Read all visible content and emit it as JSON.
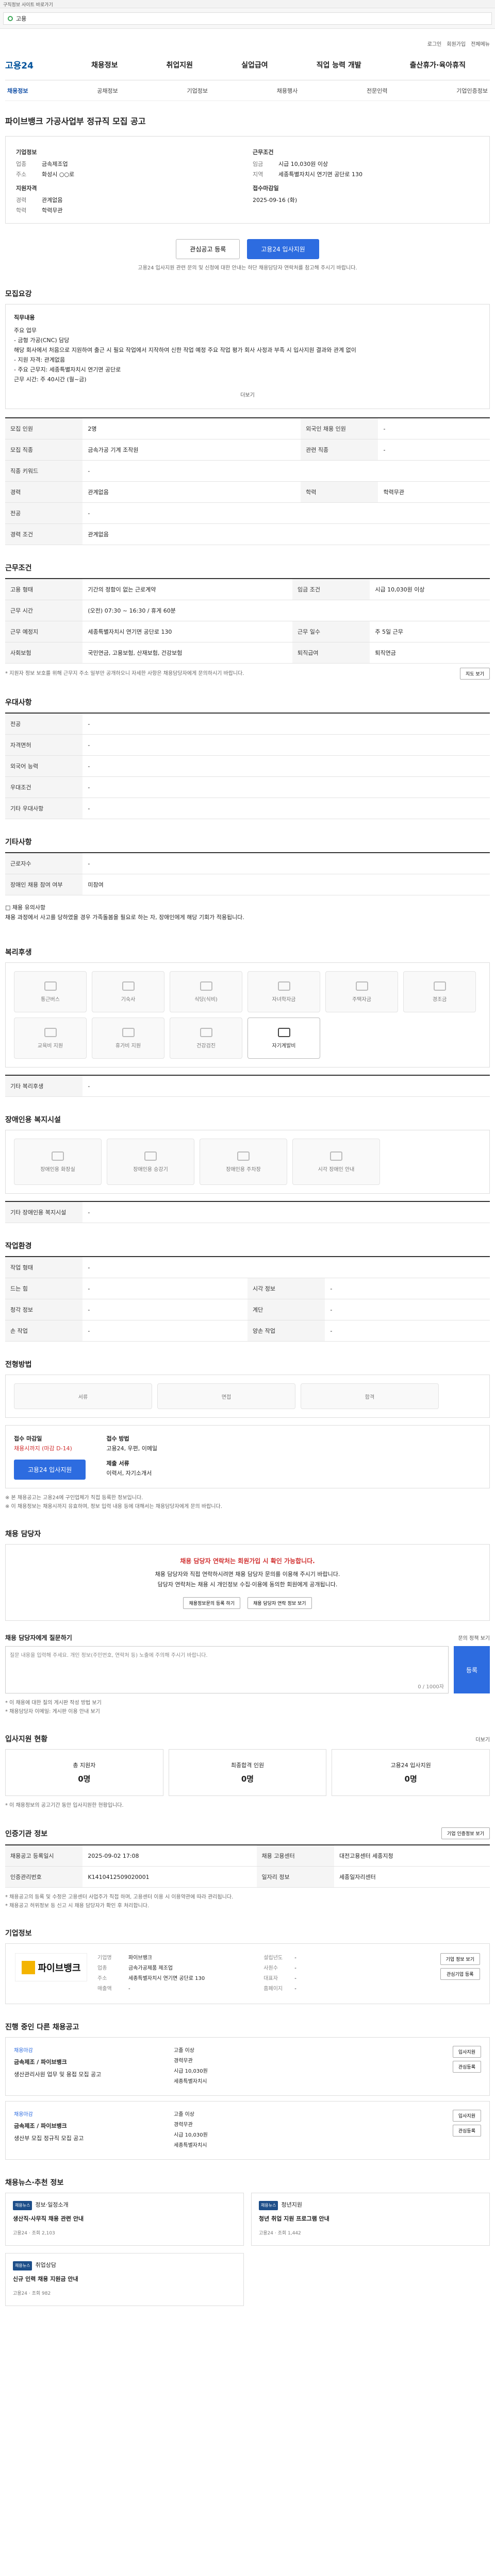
{
  "topbar": {
    "text": "구직정보 사이트 바로가기"
  },
  "search": {
    "query": "고용"
  },
  "util": [
    "로그인",
    "회원가입",
    "전체메뉴"
  ],
  "logo": "고용24",
  "gnb": [
    "채용정보",
    "취업지원",
    "실업급여",
    "직업 능력 개발",
    "출산휴가·육아휴직"
  ],
  "subnav": [
    "채용정보",
    "공채정보",
    "기업정보",
    "채용행사",
    "전문인력",
    "기업인증정보"
  ],
  "job": {
    "title": "파이브뱅크 가공사업부 정규직 모집 공고",
    "company_label": "기업정보",
    "company_rows": [
      [
        "업종",
        "금속제조업"
      ],
      [
        "주소",
        "화성시 ○○로"
      ]
    ],
    "cond_label": "근무조건",
    "cond_rows": [
      [
        "임금",
        "시급 10,030원 이상"
      ],
      [
        "지역",
        "세종특별자치시 연기면 공단로 130"
      ]
    ],
    "app_label": "지원자격",
    "app_rows": [
      [
        "경력",
        "관계없음"
      ],
      [
        "학력",
        "학력무관"
      ]
    ],
    "period_label": "접수마감일",
    "period_value": "2025-09-16 (화)",
    "scrap_btn": "관심공고 등록",
    "apply_btn": "고용24 입사지원",
    "note": "고용24 입사지원 관련 문의 및 신청에 대한 안내는 하단 채용담당자 연락처를 참고해 주시기 바랍니다."
  },
  "detail": {
    "title": "모집요강",
    "duty_label": "직무내용",
    "duty_text": "주요 업무\n- 금형 가공(CNC) 담당\n해당 회사에서 처음으로 지원하여 출근 시 필요 작업에서 지작하여 신한 작업 예정 주요 작업 평가 회사 사정과 부족 시 입사지원 결과와 관계 없이\n- 지원 자격: 관계없음\n- 주요 근무지: 세종특별자치시 연기면 공단로\n근무 시간: 주 40시간 (월~금)",
    "more": "더보기",
    "rows": [
      [
        "모집 인원",
        "2명",
        "외국인 채용 인원",
        "-"
      ],
      [
        "모집 직종",
        "금속가공 기계 조작원",
        "관련 직종",
        "-"
      ],
      [
        "직종 키워드",
        "-",
        "",
        ""
      ],
      [
        "경력",
        "관계없음",
        "학력",
        "학력무관"
      ],
      [
        "전공",
        "-",
        "",
        ""
      ],
      [
        "경력 조건",
        "관계없음",
        "",
        ""
      ]
    ]
  },
  "work": {
    "title": "근무조건",
    "rows": [
      [
        "고용 형태",
        "기간의 정함이 없는 근로계약",
        "임금 조건",
        "시급 10,030원 이상"
      ],
      [
        "근무 시간",
        "(오전) 07:30 ~ 16:30 / 휴게 60분",
        "",
        ""
      ],
      [
        "근무 예정지",
        "세종특별자치시 연기면 공단로 130",
        "근무 일수",
        "주 5일 근무"
      ],
      [
        "사회보험",
        "국민연금, 고용보험, 산재보험, 건강보험",
        "퇴직급여",
        "퇴직연금"
      ]
    ],
    "loc_map_btn": "지도 보기",
    "note": "* 지원자 정보 보호를 위해 근무지 주소 일부만 공개하오니 자세한 사항은 채용담당자에게 문의하시기 바랍니다."
  },
  "qual": {
    "title": "우대사항",
    "rows": [
      [
        "전공",
        "-"
      ],
      [
        "자격면허",
        "-"
      ],
      [
        "외국어 능력",
        "-"
      ],
      [
        "우대조건",
        "-"
      ],
      [
        "기타 우대사항",
        "-"
      ]
    ]
  },
  "etc": {
    "title": "기타사항",
    "rows": [
      [
        "근로자수",
        "-"
      ],
      [
        "장애인 채용 참여 여부",
        "미참여"
      ]
    ],
    "note": "□ 채용 유의사항\n채용 과정에서 사고를 당하였을 경우 가족돌봄을 필요로 하는 자, 장애인에게 해당 기회가 적용됩니다."
  },
  "welfare": {
    "title": "복리후생",
    "items": [
      "통근버스",
      "기숙사",
      "식당(식비)",
      "자녀학자금",
      "주택자금",
      "경조금",
      "교육비 지원",
      "휴가비 지원",
      "건강검진",
      "자기계발비"
    ],
    "active_index": 9,
    "detail_label": "기타 복리후생",
    "detail_value": "-"
  },
  "disabled": {
    "title": "장애인용 복지시설",
    "items": [
      "장애인용 화장실",
      "장애인용 승강기",
      "장애인용 주차장",
      "시각 장애인 안내"
    ],
    "extra_label": "기타 장애인용 복지시설",
    "extra_value": "-"
  },
  "worktype": {
    "title": "작업환경",
    "rows": [
      [
        "작업 형태",
        "-",
        "",
        ""
      ],
      [
        "드는 힘",
        "-",
        "시각 정보",
        "-"
      ],
      [
        "청각 정보",
        "-",
        "계단",
        "-"
      ],
      [
        "손 작업",
        "-",
        "양손 작업",
        "-"
      ]
    ]
  },
  "apply": {
    "title": "전형방법",
    "steps": [
      "서류",
      "면접",
      "합격"
    ],
    "deadline_label": "접수 마감일",
    "deadline": "채용시까지 (마감 D-14)",
    "method_label": "접수 방법",
    "method": "고용24, 우편, 이메일",
    "docs_label": "제출 서류",
    "docs": "이력서, 자기소개서",
    "apply_btn": "고용24 입사지원",
    "notes": "※ 본 채용공고는 고용24에 구인업체가 직접 등록한 정보입니다.\n※ 이 채용정보는 채용시까지 유효하며, 정보 입력 내용 등에 대해서는 채용담당자에게 문의 바랍니다."
  },
  "contact": {
    "title": "채용 담당자",
    "warn_title": "채용 담당자 연락처는 회원가입 시 확인 가능합니다.",
    "warn_text": "채용 담당자와 직접 연락하시려면 채용 담당자 문의를 이용해 주시기 바랍니다.\n담당자 연락처는 채용 시 개인정보 수집·이용에 동의한 회원에게 공개됩니다.",
    "btn1": "채용정보문의 등록 하기",
    "btn2": "채용 담당자 연락 정보 보기"
  },
  "qa": {
    "label": "채용 담당자에게 질문하기",
    "policy": "문의 정책 보기",
    "placeholder": "질문 내용을 입력해 주세요. 개인 정보(주민번호, 연락처 등) 노출에 주의해 주시기 바랍니다.",
    "counter": "0 / 1000자",
    "submit": "등록",
    "notes": "* 이 채용에 대한 질의 게시판 작성 방법 보기\n* 채용담당자 이메일: 게시판 이용 안내 보기"
  },
  "stats": {
    "title": "입사지원 현황",
    "more": "더보기",
    "items": [
      [
        "총 지원자",
        "0명"
      ],
      [
        "최종합격 인원",
        "0명"
      ],
      [
        "고용24 입사지원",
        "0명"
      ]
    ],
    "note": "* 이 채용정보의 공고기간 동안 입사지원한 현황입니다."
  },
  "history": {
    "title": "인증기관 정보",
    "btn": "기업 인증정보 보기",
    "rows": [
      [
        "채용공고 등록일시",
        "2025-09-02 17:08",
        "채용 고용센터",
        "대전고용센터 세종지청"
      ],
      [
        "인증관리번호",
        "K1410412509020001",
        "일자리 정보",
        "세종일자리센터"
      ]
    ],
    "notes": "* 채용공고의 등록 및 수정은 고용센터 사업주가 직접 하며, 고용센터 이용 시 이용약관에 따라 관리됩니다.\n* 채용공고 허위정보 등 신고 시 채용 담당자가 확인 후 처리합니다."
  },
  "company": {
    "title": "기업정보",
    "logo_text": "파이브뱅크",
    "rows": [
      [
        "기업명",
        "파이브뱅크",
        "설립년도",
        "-"
      ],
      [
        "업종",
        "금속가공제품 제조업",
        "사원수",
        "-"
      ],
      [
        "주소",
        "세종특별자치시 연기면 공단로 130",
        "대표자",
        "-"
      ],
      [
        "매출액",
        "-",
        "홈페이지",
        "-"
      ]
    ],
    "btn1": "기업 정보 보기",
    "btn2": "관심기업 등록"
  },
  "related": {
    "title": "진행 중인 다른 채용공고",
    "cards": [
      {
        "tag": "채용마감",
        "name": "금속제조 / 파이브뱅크",
        "job": "생산관리사원 업무 및 용접 모집 공고",
        "info": [
          "고졸 이상",
          "경력무관",
          "시급 10,030원",
          "세종특별자치시"
        ],
        "btn1": "입사지원",
        "btn2": "관심등록"
      },
      {
        "tag": "채용마감",
        "name": "금속제조 / 파이브뱅크",
        "job": "생산부 모집 정규직 모집 공고",
        "info": [
          "고졸 이상",
          "경력무관",
          "시급 10,030원",
          "세종특별자치시"
        ],
        "btn1": "입사지원",
        "btn2": "관심등록"
      }
    ]
  },
  "news": {
    "title": "채용뉴스·추천 정보",
    "items": [
      {
        "badge": "채용뉴스",
        "cat": "정보·일정소개",
        "title": "생산직·사무직 채용 관련 안내",
        "meta": "고용24 · 조회 2,103"
      },
      {
        "badge": "채용뉴스",
        "cat": "청년지원",
        "title": "청년 취업 지원 프로그램 안내",
        "meta": "고용24 · 조회 1,442"
      },
      {
        "badge": "채용뉴스",
        "cat": "취업상담",
        "title": "신규 인력 채용 지원금 안내",
        "meta": "고용24 · 조회 982"
      }
    ]
  }
}
